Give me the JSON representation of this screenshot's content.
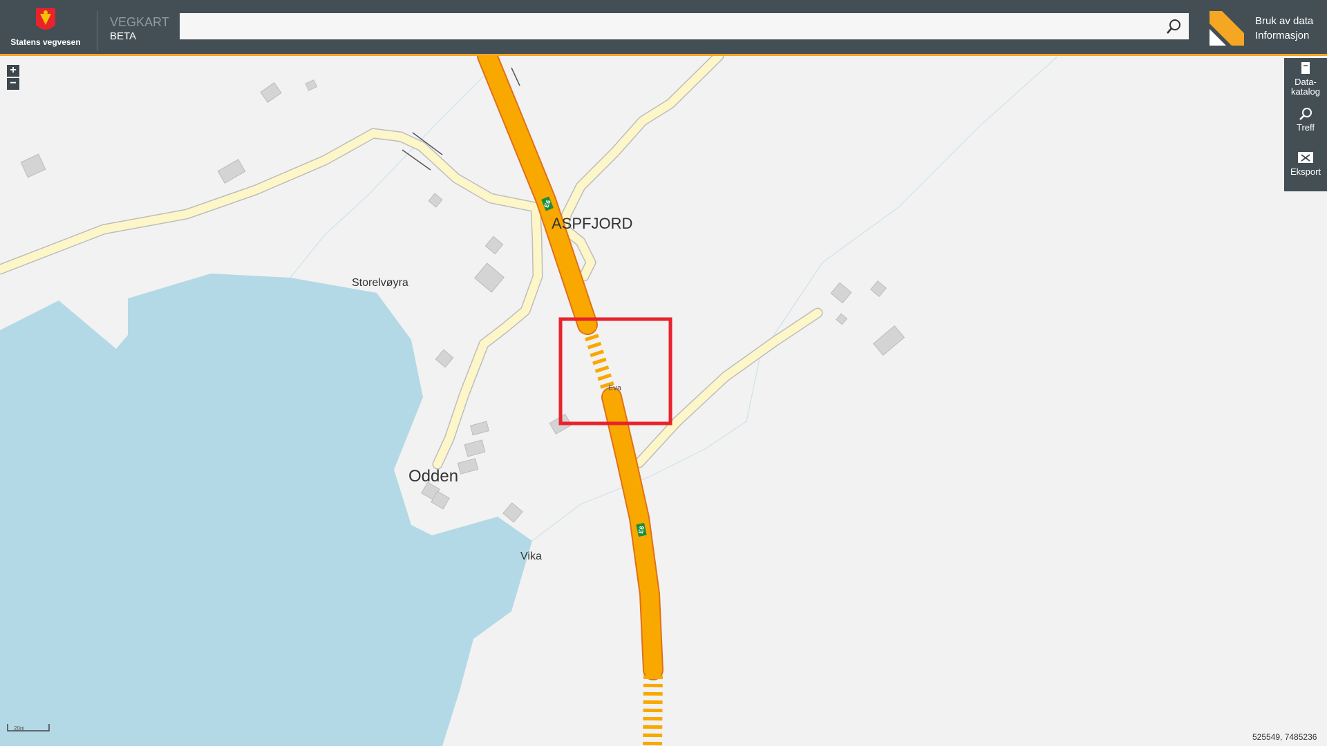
{
  "header": {
    "logo_text": "Statens vegvesen",
    "app_name": "VEGKART",
    "app_sub": "BETA",
    "search": {
      "value": "",
      "placeholder": ""
    },
    "search_icon": "search-icon",
    "links": {
      "bruk": "Bruk av data",
      "info": "Informasjon"
    }
  },
  "map": {
    "labels": {
      "aspfjord": "ASPFJORD",
      "storelvoyra": "Storelvøyra",
      "odden": "Odden",
      "vika": "Vika",
      "eva": "Eva",
      "road_shield_1": "E6",
      "road_shield_2": "E6"
    },
    "zoom_in": "+",
    "zoom_out": "−",
    "scale": "20m",
    "coordinates": "525549, 7485236"
  },
  "sidebar": {
    "items": [
      {
        "label_1": "Data-",
        "label_2": "katalog",
        "icon": "book-icon"
      },
      {
        "label": "Treff",
        "icon": "search-icon"
      },
      {
        "label": "Eksport",
        "icon": "export-icon"
      }
    ]
  },
  "colors": {
    "header": "#444f55",
    "accent": "#f5a623",
    "water": "#b3d9e6",
    "road_major": "#f9a800",
    "road_minor": "#fdf6c8",
    "highlight": "#e8232b"
  }
}
